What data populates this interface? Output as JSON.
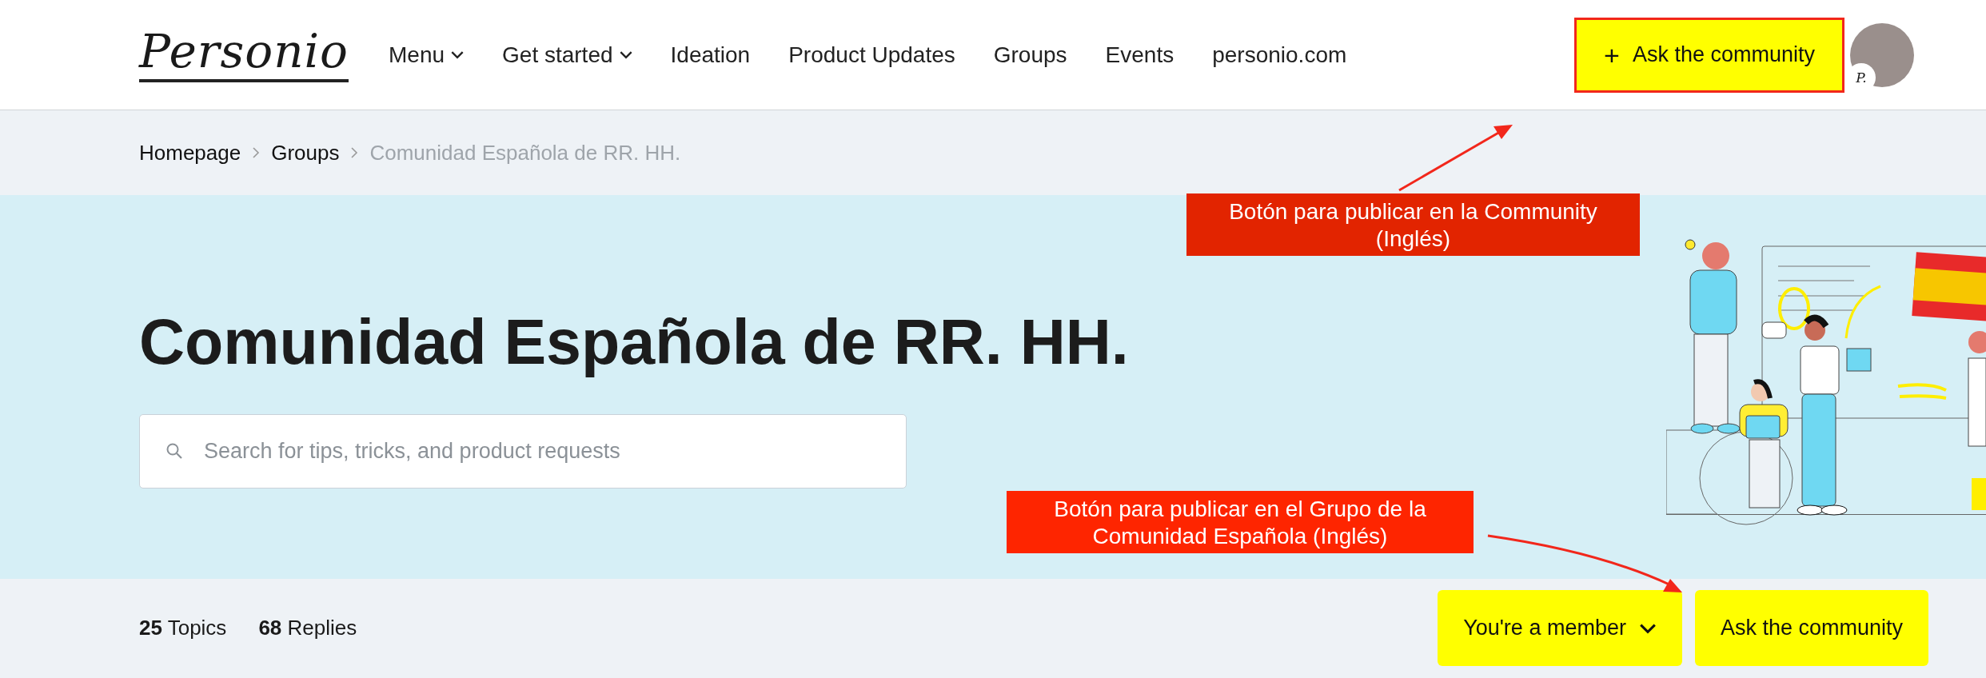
{
  "header": {
    "logo": "Personio",
    "nav": [
      {
        "label": "Menu",
        "dropdown": true
      },
      {
        "label": "Get started",
        "dropdown": true
      },
      {
        "label": "Ideation",
        "dropdown": false
      },
      {
        "label": "Product Updates",
        "dropdown": false
      },
      {
        "label": "Groups",
        "dropdown": false
      },
      {
        "label": "Events",
        "dropdown": false
      },
      {
        "label": "personio.com",
        "dropdown": false
      }
    ],
    "ask_button": {
      "icon": "+",
      "label": "Ask the community",
      "highlighted": true
    },
    "avatar_badge": "P."
  },
  "breadcrumb": [
    {
      "label": "Homepage",
      "current": false
    },
    {
      "label": "Groups",
      "current": false
    },
    {
      "label": "Comunidad Española de RR. HH.",
      "current": true
    }
  ],
  "hero": {
    "title": "Comunidad Española de RR. HH.",
    "search": {
      "placeholder": "Search for tips, tricks, and product requests"
    }
  },
  "stats": [
    "**25** Topics",
    "**68** Replies"
  ],
  "actions": [
    {
      "label": "You're a member",
      "dropdown": true
    },
    {
      "label": "Ask the community",
      "dropdown": false
    }
  ],
  "annotations": [
    {
      "lines": [
        "Botón para publicar en la Community",
        "(Inglés)"
      ],
      "color": "#e22400"
    },
    {
      "lines": [
        "Botón para publicar en el Grupo de la",
        "Comunidad Española (Inglés)"
      ],
      "color": "#fe2500"
    }
  ]
}
